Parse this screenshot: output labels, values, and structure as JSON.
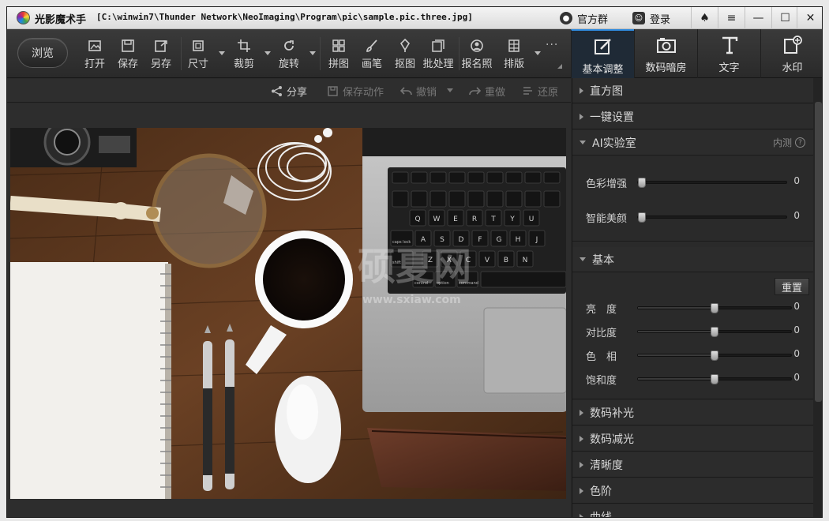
{
  "titlebar": {
    "app_name": "光影魔术手",
    "file_path": "[C:\\winwin7\\Thunder Network\\NeoImaging\\Program\\pic\\sample.pic.three.jpg]",
    "group_label": "官方群",
    "login_label": "登录"
  },
  "toolbar": {
    "browse": "浏览",
    "tools": [
      {
        "label": "打开",
        "icon": "open-icon"
      },
      {
        "label": "保存",
        "icon": "save-icon"
      },
      {
        "label": "另存",
        "icon": "save-as-icon"
      },
      {
        "label": "尺寸",
        "icon": "resize-icon"
      },
      {
        "label": "裁剪",
        "icon": "crop-icon"
      },
      {
        "label": "旋转",
        "icon": "rotate-icon"
      },
      {
        "label": "拼图",
        "icon": "collage-icon"
      },
      {
        "label": "画笔",
        "icon": "brush-icon"
      },
      {
        "label": "抠图",
        "icon": "cutout-icon"
      },
      {
        "label": "批处理",
        "icon": "batch-icon"
      },
      {
        "label": "报名照",
        "icon": "id-photo-icon"
      },
      {
        "label": "排版",
        "icon": "layout-icon"
      }
    ],
    "modes": [
      {
        "label": "基本调整",
        "icon": "basic-adjust-icon",
        "active": true
      },
      {
        "label": "数码暗房",
        "icon": "darkroom-icon",
        "active": false
      },
      {
        "label": "文字",
        "icon": "text-icon",
        "active": false
      },
      {
        "label": "水印",
        "icon": "watermark-icon",
        "active": false
      }
    ]
  },
  "subbar": {
    "share": "分享",
    "save_action": "保存动作",
    "undo": "撤销",
    "redo": "重做",
    "restore": "还原"
  },
  "photo": {
    "watermark_main": "硕夏网",
    "watermark_url": "www.sxiaw.com",
    "keyboard_keys": [
      "Q",
      "W",
      "E",
      "R",
      "T",
      "Y",
      "U",
      "A",
      "S",
      "D",
      "F",
      "G",
      "H",
      "J",
      "Z",
      "X",
      "C",
      "V",
      "B",
      "N"
    ],
    "keyboard_labels": [
      "caps lock",
      "shift",
      "control",
      "option",
      "command"
    ]
  },
  "panel": {
    "histogram": "直方图",
    "one_click": "一键设置",
    "ai_lab": "AI实验室",
    "ai_lab_note": "内测",
    "ai_sliders": [
      {
        "label": "色彩增强",
        "value": "0",
        "position": 0.0
      },
      {
        "label": "智能美颜",
        "value": "0",
        "position": 0.0
      }
    ],
    "basic": "基本",
    "reset": "重置",
    "basic_sliders": [
      {
        "label": "亮　度",
        "value": "0",
        "position": 0.5
      },
      {
        "label": "对比度",
        "value": "0",
        "position": 0.5
      },
      {
        "label": "色　相",
        "value": "0",
        "position": 0.5
      },
      {
        "label": "饱和度",
        "value": "0",
        "position": 0.5
      }
    ],
    "collapsed_sections": [
      "数码补光",
      "数码减光",
      "清晰度",
      "色阶",
      "曲线"
    ]
  }
}
